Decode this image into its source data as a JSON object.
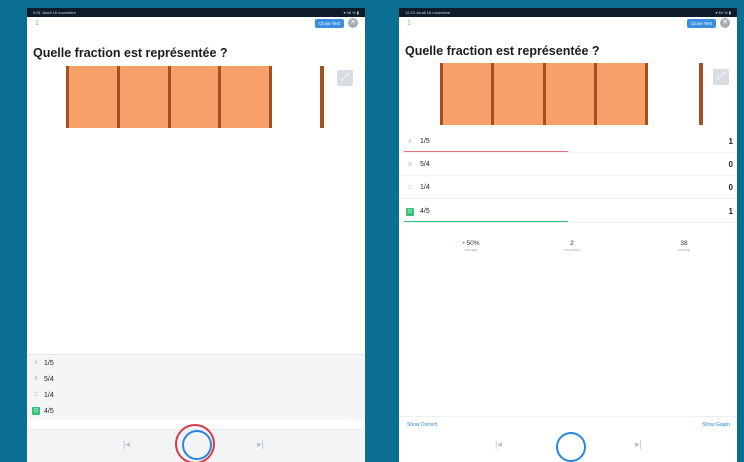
{
  "left_screen": {
    "status_left": "9:31 Jeudi 16 novembre",
    "status_right": "▾ 46 % ▮",
    "question_number": "1",
    "close_button": "Close Test",
    "close_icon": "✕",
    "question": "Quelle fraction est représentée ?",
    "answers": [
      {
        "letter": "A",
        "label": "1/5",
        "correct": false
      },
      {
        "letter": "B",
        "label": "5/4",
        "correct": false
      },
      {
        "letter": "C",
        "label": "1/4",
        "correct": false
      },
      {
        "letter": "D",
        "label": "4/5",
        "correct": true
      }
    ],
    "nav_prev": "|◂",
    "nav_next": "▸|"
  },
  "right_screen": {
    "status_left": "12:23 Jeudi 16 novembre",
    "status_right": "▾ 64 % ▮",
    "question_number": "1",
    "close_button": "Close Test",
    "close_icon": "✕",
    "question": "Quelle fraction est représentée ?",
    "answers": [
      {
        "letter": "A",
        "label": "1/5",
        "count": "1",
        "correct": false,
        "bar_color": "#e9767b",
        "bar_fraction": 0.5
      },
      {
        "letter": "B",
        "label": "5/4",
        "count": "0",
        "correct": false
      },
      {
        "letter": "C",
        "label": "1/4",
        "count": "0",
        "correct": false
      },
      {
        "letter": "D",
        "label": "4/5",
        "count": "1",
        "correct": true,
        "bar_color": "#35c17a",
        "bar_fraction": 0.5
      }
    ],
    "stats": [
      {
        "value": "50%",
        "label": "average"
      },
      {
        "value": "2",
        "label": "responses"
      },
      {
        "value": "38",
        "label": "missing"
      }
    ],
    "show_correct": "Show Correct",
    "show_graph": "Show Graph",
    "nav_prev": "|◂",
    "nav_next": "▸|"
  },
  "colors": {
    "background": "#0a6f93",
    "accent": "#2b86e0",
    "fraction_fill": "#f7a069",
    "divider": "#a2521f",
    "annotation": "#d63b47"
  },
  "icons": [
    "close-icon",
    "expand-icon",
    "prev-icon",
    "next-icon",
    "home-icon"
  ]
}
